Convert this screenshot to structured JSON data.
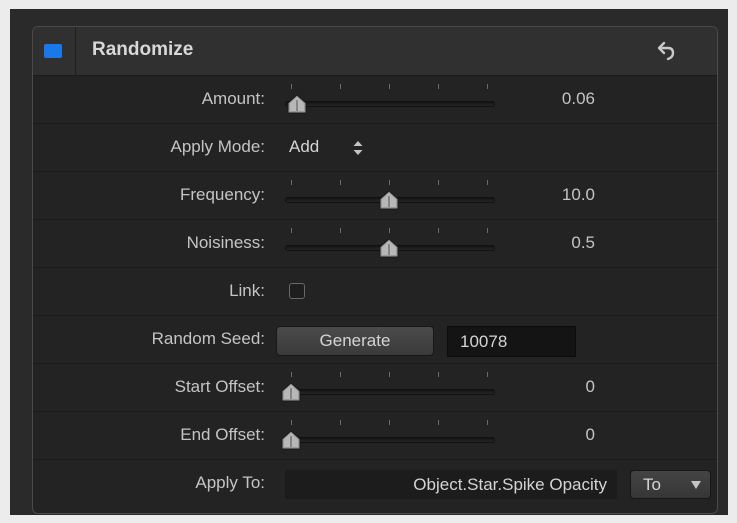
{
  "panel": {
    "title": "Randomize",
    "enabled": true,
    "accent_color": "#1b78e8",
    "reset_icon": "undo-arrow-icon"
  },
  "params": {
    "amount": {
      "label": "Amount:",
      "value": "0.06",
      "slider_fraction": 0.03
    },
    "apply_mode": {
      "label": "Apply Mode:",
      "value": "Add"
    },
    "frequency": {
      "label": "Frequency:",
      "value": "10.0",
      "slider_fraction": 0.5
    },
    "noisiness": {
      "label": "Noisiness:",
      "value": "0.5",
      "slider_fraction": 0.5
    },
    "link": {
      "label": "Link:",
      "checked": false
    },
    "random_seed": {
      "label": "Random Seed:",
      "button_label": "Generate",
      "value": "10078"
    },
    "start_offset": {
      "label": "Start Offset:",
      "value": "0",
      "slider_fraction": 0.0
    },
    "end_offset": {
      "label": "End Offset:",
      "value": "0",
      "slider_fraction": 0.0
    },
    "apply_to": {
      "label": "Apply To:",
      "value": "Object.Star.Spike Opacity",
      "menu_label": "To"
    }
  }
}
